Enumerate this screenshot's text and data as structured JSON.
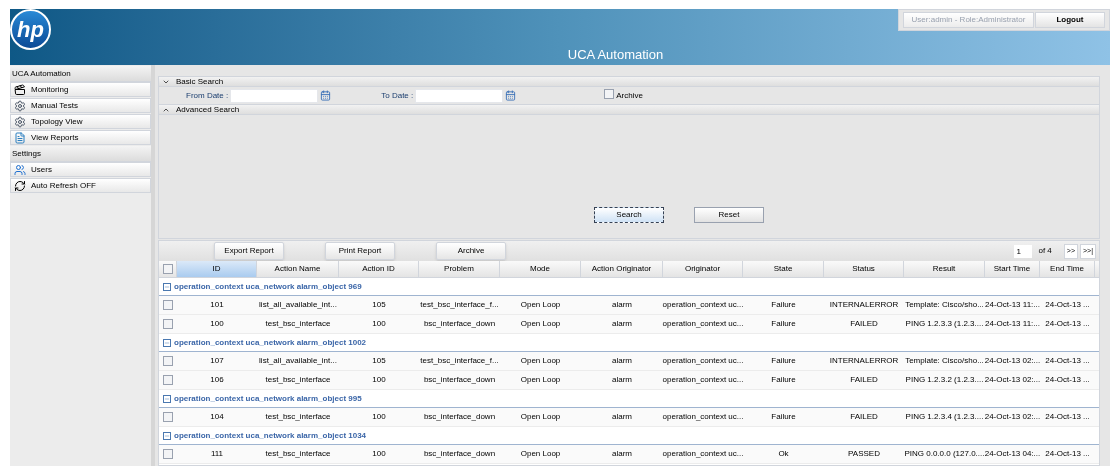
{
  "header": {
    "logo": "hp",
    "title": "UCA Automation",
    "user_info": "User:admin - Role:Administrator",
    "logout": "Logout"
  },
  "sidebar": {
    "sections": [
      {
        "title": "UCA Automation",
        "items": [
          {
            "label": "Monitoring",
            "kind": "clapper"
          },
          {
            "label": "Manual Tests",
            "kind": "gear"
          },
          {
            "label": "Topology View",
            "kind": "gear"
          },
          {
            "label": "View Reports",
            "kind": "report"
          }
        ]
      },
      {
        "title": "Settings",
        "items": [
          {
            "label": "Users",
            "kind": "users"
          },
          {
            "label": "Auto Refresh OFF",
            "kind": "refresh"
          }
        ]
      }
    ]
  },
  "basic_search": {
    "title": "Basic Search",
    "expanded": true,
    "from_label": "From Date :",
    "to_label": "To Date :",
    "archive_label": "Archive",
    "archive_checked": false
  },
  "advanced_search": {
    "title": "Advanced Search",
    "expanded": false
  },
  "search_buttons": [
    {
      "label": "Search",
      "focused": true
    },
    {
      "label": "Reset",
      "focused": false
    }
  ],
  "toolbar": {
    "buttons": [
      "Export Report",
      "Print Report",
      "Archive"
    ],
    "page": "1",
    "page_of": "of 4",
    "next": ">>",
    "last": ">>|"
  },
  "table": {
    "all_checked": false,
    "columns": [
      {
        "label": "ID",
        "selected": true
      },
      {
        "label": "Action Name",
        "selected": false
      },
      {
        "label": "Action ID",
        "selected": false
      },
      {
        "label": "Problem",
        "selected": false
      },
      {
        "label": "Mode",
        "selected": false
      },
      {
        "label": "Action Originator",
        "selected": false
      },
      {
        "label": "Originator",
        "selected": false
      },
      {
        "label": "State",
        "selected": false
      },
      {
        "label": "Status",
        "selected": false
      },
      {
        "label": "Result",
        "selected": false
      },
      {
        "label": "Start Time",
        "selected": false
      },
      {
        "label": "End Time",
        "selected": false
      }
    ],
    "groups": [
      {
        "label": "operation_context uca_network alarm_object 969",
        "expanded": true,
        "rows": [
          {
            "checked": false,
            "cells": [
              "101",
              "list_all_available_int...",
              "105",
              "test_bsc_interface_f...",
              "Open Loop",
              "alarm",
              "operation_context uc...",
              "Failure",
              "INTERNALERROR",
              "Template: Cisco/sho...",
              "24-Oct-13 11:...",
              "24-Oct-13 ..."
            ]
          },
          {
            "checked": false,
            "cells": [
              "100",
              "test_bsc_interface",
              "100",
              "bsc_interface_down",
              "Open Loop",
              "alarm",
              "operation_context uc...",
              "Failure",
              "FAILED",
              "PING 1.2.3.3 (1.2.3....",
              "24-Oct-13 11:...",
              "24-Oct-13 ..."
            ]
          }
        ]
      },
      {
        "label": "operation_context uca_network alarm_object 1002",
        "expanded": true,
        "rows": [
          {
            "checked": false,
            "cells": [
              "107",
              "list_all_available_int...",
              "105",
              "test_bsc_interface_f...",
              "Open Loop",
              "alarm",
              "operation_context uc...",
              "Failure",
              "INTERNALERROR",
              "Template: Cisco/sho...",
              "24-Oct-13 02:...",
              "24-Oct-13 ..."
            ]
          },
          {
            "checked": false,
            "cells": [
              "106",
              "test_bsc_interface",
              "100",
              "bsc_interface_down",
              "Open Loop",
              "alarm",
              "operation_context uc...",
              "Failure",
              "FAILED",
              "PING 1.2.3.2 (1.2.3....",
              "24-Oct-13 02:...",
              "24-Oct-13 ..."
            ]
          }
        ]
      },
      {
        "label": "operation_context uca_network alarm_object 995",
        "expanded": true,
        "rows": [
          {
            "checked": false,
            "cells": [
              "104",
              "test_bsc_interface",
              "100",
              "bsc_interface_down",
              "Open Loop",
              "alarm",
              "operation_context uc...",
              "Failure",
              "FAILED",
              "PING 1.2.3.4 (1.2.3....",
              "24-Oct-13 02:...",
              "24-Oct-13 ..."
            ]
          }
        ]
      },
      {
        "label": "operation_context uca_network alarm_object 1034",
        "expanded": true,
        "rows": [
          {
            "checked": false,
            "cells": [
              "111",
              "test_bsc_interface",
              "100",
              "bsc_interface_down",
              "Open Loop",
              "alarm",
              "operation_context uc...",
              "Ok",
              "PASSED",
              "PING 0.0.0.0 (127.0....",
              "24-Oct-13 04:...",
              "24-Oct-13 ..."
            ]
          }
        ]
      }
    ]
  }
}
